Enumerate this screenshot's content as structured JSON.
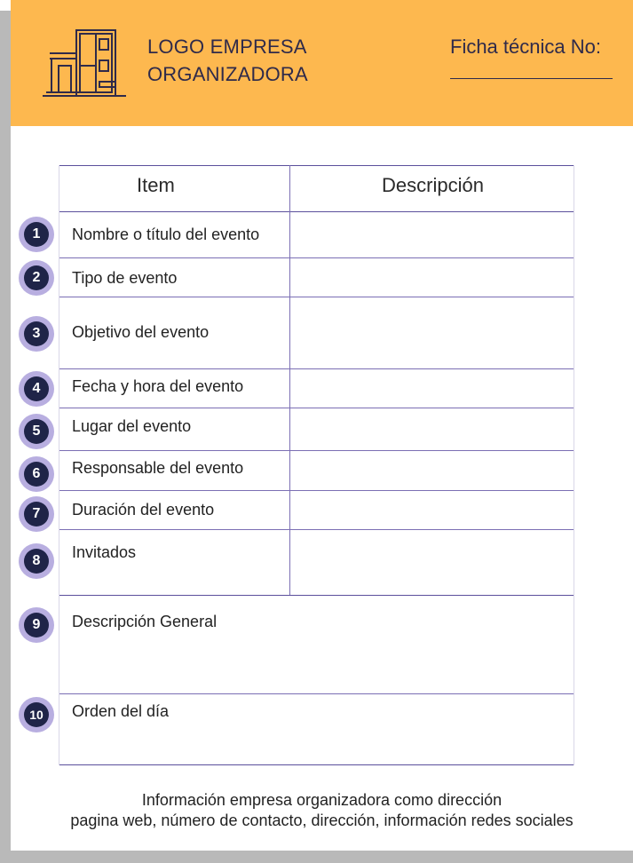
{
  "header": {
    "logo_line1": "LOGO EMPRESA",
    "logo_line2": "ORGANIZADORA",
    "ficha_label": "Ficha técnica No:",
    "logo_icon": "building-icon",
    "background_color": "#fdb84f"
  },
  "table": {
    "col_item": "Item",
    "col_description": "Descripción",
    "rows": [
      {
        "number": "1",
        "label": "Nombre o título del evento"
      },
      {
        "number": "2",
        "label": "Tipo de evento"
      },
      {
        "number": "3",
        "label": "Objetivo del evento"
      },
      {
        "number": "4",
        "label": "Fecha y hora del evento"
      },
      {
        "number": "5",
        "label": "Lugar del evento"
      },
      {
        "number": "6",
        "label": "Responsable del evento"
      },
      {
        "number": "7",
        "label": "Duración del evento"
      },
      {
        "number": "8",
        "label": "Invitados"
      },
      {
        "number": "9",
        "label": "Descripción General"
      },
      {
        "number": "10",
        "label": "Orden del día"
      }
    ]
  },
  "footer": {
    "line1": "Información empresa organizadora como dirección",
    "line2": "pagina web, número de contacto, dirección, información redes sociales"
  }
}
